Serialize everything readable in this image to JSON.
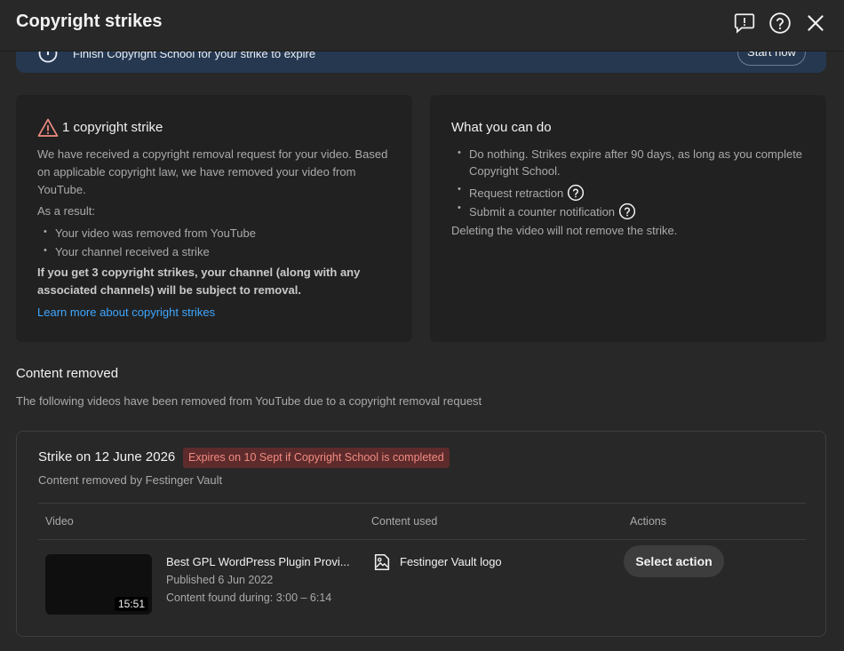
{
  "header": {
    "title": "Copyright strikes"
  },
  "banner": {
    "text": "Finish Copyright School for your strike to expire",
    "button_label": "Start now"
  },
  "strike_card": {
    "title": "1 copyright strike",
    "paragraph": "We have received a copyright removal request for your video. Based on applicable copyright law, we have removed your video from YouTube.",
    "paragraph_lines": [
      "We have received a copyright removal request for your video. Based",
      "on applicable copyright law, we have removed your video from",
      "YouTube."
    ],
    "result_label": "As a result:",
    "results": [
      "Your video was removed from YouTube",
      "Your channel received a strike"
    ],
    "warning_lines": [
      "If you get 3 copyright strikes, your channel (along with any",
      "associated channels) will be subject to removal."
    ],
    "learn_more": "Learn more about copyright strikes"
  },
  "what_you_can_do": {
    "title": "What you can do",
    "options": [
      {
        "line1": "Do nothing. Strikes expire after 90 days, as long as you complete",
        "line2": "Copyright School."
      },
      {
        "line1": "Request retraction"
      },
      {
        "line1": "Submit a counter notification"
      }
    ],
    "note": "Deleting the video will not remove the strike."
  },
  "content_removed": {
    "title": "Content removed",
    "description": "The following videos have been removed from YouTube due to a copyright removal request"
  },
  "strike": {
    "title": "Strike on 12 June 2026",
    "badge": "Expires on 10 Sept if Copyright School is completed",
    "removed_by": "Content removed by Festinger Vault",
    "columns": [
      "Video",
      "Content used",
      "Actions"
    ],
    "video": {
      "title": "Best GPL WordPress Plugin Provi...",
      "published": "Published 6 Jun 2022",
      "found": "Content found during: 3:00 – 6:14",
      "duration": "15:51"
    },
    "content_used": "Festinger Vault logo",
    "action_label": "Select action"
  },
  "colors": {
    "background": "#282828",
    "card": "#212121",
    "banner": "#263850",
    "link": "#3ea6ff",
    "warning": "#f28b82",
    "badge_bg": "#5d2b2b"
  }
}
